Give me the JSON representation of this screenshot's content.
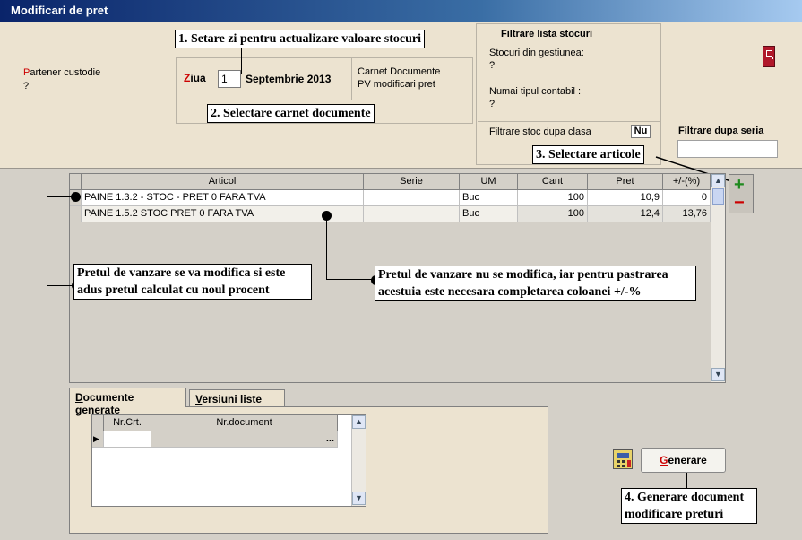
{
  "window": {
    "title": "Modificari de pret"
  },
  "partner": {
    "label_prefix": "P",
    "label_rest": "artener custodie",
    "value": "?"
  },
  "date": {
    "label_first": "Z",
    "label_rest": "iua",
    "day": "1",
    "month_year": "Septembrie 2013"
  },
  "carnet": {
    "label": "Carnet Documente",
    "value": "PV modificari pret"
  },
  "filter": {
    "title": "Filtrare lista stocuri",
    "stock_label": "Stocuri din gestiunea:",
    "stock_value": "?",
    "type_label": "Numai tipul contabil :",
    "type_value": "?",
    "class_label": "Filtrare stoc dupa clasa",
    "class_value": "Nu",
    "series_label": "Filtrare dupa seria",
    "series_value": ""
  },
  "callouts": {
    "c1": "1. Setare zi pentru actualizare valoare stocuri",
    "c2": "2. Selectare carnet documente",
    "c3": "3. Selectare articole",
    "c4a": "4. Generare document",
    "c4b": "modificare preturi",
    "c5a": "Pretul de vanzare se va modifica si este",
    "c5b": "adus pretul  calculat cu noul procent",
    "c6a": "Pretul de vanzare nu se modifica, iar pentru pastrarea",
    "c6b": "acestuia este necesara completarea coloanei +/-%"
  },
  "grid": {
    "columns": [
      "Articol",
      "Serie",
      "UM",
      "Cant",
      "Pret",
      "+/-(%)"
    ],
    "rows": [
      {
        "articol": "PAINE 1.3.2 - STOC - PRET 0 FARA TVA",
        "serie": "",
        "um": "Buc",
        "cant": "100",
        "pret": "10,9",
        "pct": "0"
      },
      {
        "articol": "PAINE 1.5.2 STOC PRET 0 FARA TVA",
        "serie": "",
        "um": "Buc",
        "cant": "100",
        "pret": "12,4",
        "pct": "13,76"
      }
    ]
  },
  "tabs": {
    "t1": "Documente generate",
    "t1_u": "D",
    "t2": "Versiuni liste",
    "t2_u": "V"
  },
  "docs": {
    "columns": [
      "Nr.Crt.",
      "Nr.document"
    ],
    "ellipsis": "..."
  },
  "buttons": {
    "generate_first": "G",
    "generate_rest": "enerare"
  },
  "icons": {
    "plus": "+",
    "minus": "−",
    "up": "▲",
    "down": "▼",
    "row_pointer": "▶"
  },
  "colors": {
    "accent_red": "#cc0000",
    "plus_green": "#1f8a1f"
  }
}
